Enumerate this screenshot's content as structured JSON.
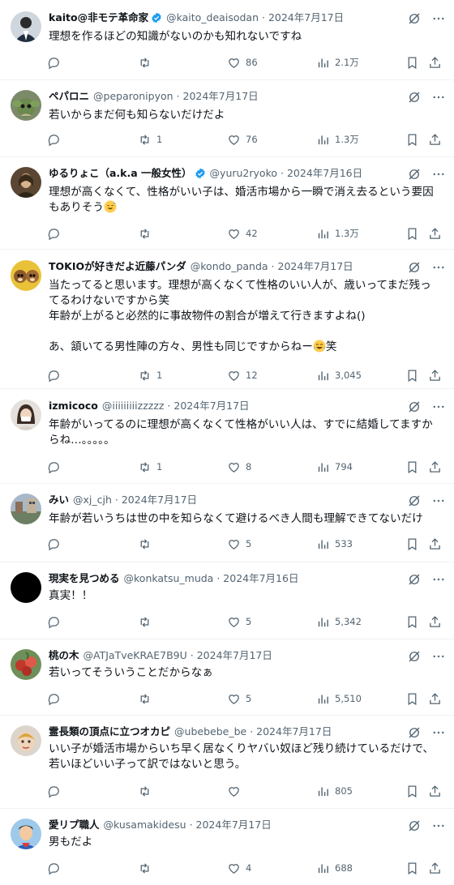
{
  "colors": {
    "text": "#0f1419",
    "muted": "#536471",
    "divider": "#eff3f4",
    "verified": "#1d9bf0"
  },
  "tweets": [
    {
      "name": "kaito@非モテ革命家",
      "verified": true,
      "handle": "@kaito_deaisodan",
      "sep": "·",
      "date": "2024年7月17日",
      "text": "理想を作るほどの知識がないのかも知れないですね",
      "replies": "",
      "retweets": "",
      "likes": "86",
      "views": "2.1万",
      "avatar_icon": "avatar-suit-icon"
    },
    {
      "name": "ペパロニ",
      "verified": false,
      "handle": "@peparonipyon",
      "sep": "·",
      "date": "2024年7月17日",
      "text": "若いからまだ何も知らないだけだよ",
      "replies": "",
      "retweets": "1",
      "likes": "76",
      "views": "1.3万",
      "avatar_icon": "avatar-creature-icon"
    },
    {
      "name": "ゆるりょこ（a.k.a 一般女性）",
      "verified": true,
      "handle": "@yuru2ryoko",
      "sep": "·",
      "date": "2024年7月16日",
      "text": "理想が高くなくて、性格がいい子は、婚活市場から一瞬で消え去るという要因もありそう",
      "emoji": "sweat-smile-emoji",
      "replies": "",
      "retweets": "",
      "likes": "42",
      "views": "1.3万",
      "avatar_icon": "avatar-portrait-icon"
    },
    {
      "name": "TOKIOが好きだよ近藤パンダ",
      "verified": false,
      "handle": "@kondo_panda",
      "sep": "·",
      "date": "2024年7月17日",
      "text": "当たってると思います。理想が高くなくて性格のいい人が、歳いってまだ残ってるわけないですから笑\n年齢が上がると必然的に事故物件の割合が増えて行きますよね()\n\nあ、頷いてる男性陣の方々、男性も同じですからねー",
      "text_tail": "笑",
      "emoji": "laugh-cry-emoji",
      "replies": "",
      "retweets": "1",
      "likes": "12",
      "views": "3,045",
      "avatar_icon": "avatar-chipmunk-icon"
    },
    {
      "name": "izmicoco",
      "verified": false,
      "handle": "@iiiiiiiiizzzzz",
      "sep": "·",
      "date": "2024年7月17日",
      "text": "年齢がいってるのに理想が高くなくて性格がいい人は、すでに結婚してますからね…。。。。。",
      "replies": "",
      "retweets": "1",
      "likes": "8",
      "views": "794",
      "avatar_icon": "avatar-woman-icon"
    },
    {
      "name": "みい",
      "verified": false,
      "handle": "@xj_cjh",
      "sep": "·",
      "date": "2024年7月17日",
      "text": "年齢が若いうちは世の中を知らなくて避けるべき人間も理解できてないだけ",
      "replies": "",
      "retweets": "",
      "likes": "5",
      "views": "533",
      "avatar_icon": "avatar-scenery-icon"
    },
    {
      "name": "現実を見つめる",
      "verified": false,
      "handle": "@konkatsu_muda",
      "sep": "·",
      "date": "2024年7月16日",
      "text": "真実！！",
      "replies": "",
      "retweets": "",
      "likes": "5",
      "views": "5,342",
      "avatar_icon": "avatar-black-icon"
    },
    {
      "name": "桃の木",
      "verified": false,
      "handle": "@ATJaTveKRAE7B9U",
      "sep": "·",
      "date": "2024年7月17日",
      "text": "若いってそういうことだからなぁ",
      "replies": "",
      "retweets": "",
      "likes": "5",
      "views": "5,510",
      "avatar_icon": "avatar-peach-icon"
    },
    {
      "name": "霊長類の頂点に立つオカピ",
      "verified": false,
      "handle": "@ubebebe_be",
      "sep": "·",
      "date": "2024年7月17日",
      "text": "いい子が婚活市場からいち早く居なくりヤバい奴ほど残り続けているだけで、若いほどいい子って訳ではないと思う。",
      "replies": "",
      "retweets": "",
      "likes": "",
      "views": "805",
      "avatar_icon": "avatar-doll-icon"
    },
    {
      "name": "愛リプ職人",
      "verified": false,
      "handle": "@kusamakidesu",
      "sep": "·",
      "date": "2024年7月17日",
      "text": "男もだよ",
      "replies": "",
      "retweets": "",
      "likes": "4",
      "views": "688",
      "avatar_icon": "avatar-hero-icon"
    }
  ]
}
